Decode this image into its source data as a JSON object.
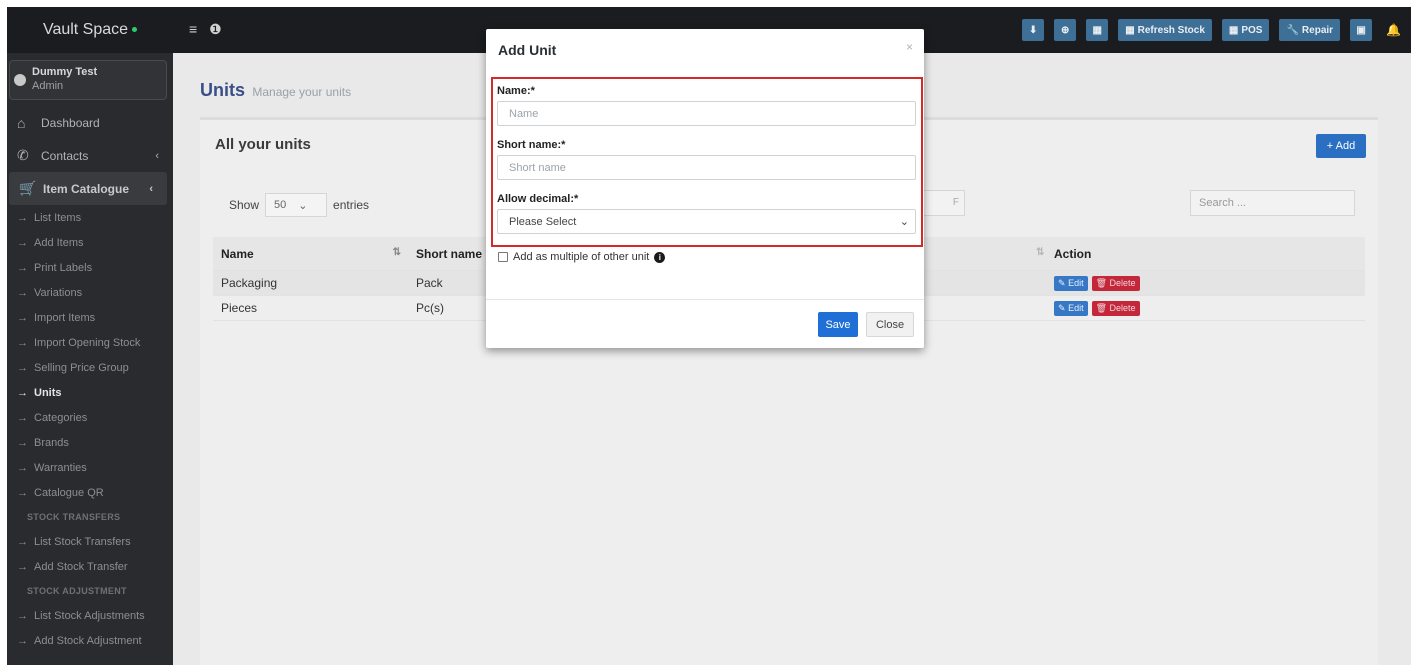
{
  "brand": "Vault Space",
  "topbar_icons": [
    "≡",
    "❶"
  ],
  "topbar_buttons": {
    "download": "⬇",
    "add": "⊕",
    "calculator": "▦",
    "refresh_stock": "Refresh Stock",
    "pos": "POS",
    "repair": "Repair",
    "cash": "▣",
    "bell": "🔔"
  },
  "user": {
    "name": "Dummy Test",
    "role": "Admin"
  },
  "sidebar": {
    "dashboard": "Dashboard",
    "contacts": "Contacts",
    "item_catalogue": "Item Catalogue",
    "catalogue_items": [
      "List Items",
      "Add Items",
      "Print Labels",
      "Variations",
      "Import Items",
      "Import Opening Stock",
      "Selling Price Group",
      "Units",
      "Categories",
      "Brands",
      "Warranties",
      "Catalogue QR"
    ],
    "stock_transfers_heading": "STOCK TRANSFERS",
    "stock_transfers_items": [
      "List Stock Transfers",
      "Add Stock Transfer"
    ],
    "stock_adjustment_heading": "STOCK ADJUSTMENT",
    "stock_adjustment_items": [
      "List Stock Adjustments",
      "Add Stock Adjustment"
    ]
  },
  "page": {
    "title": "Units",
    "subtitle": "Manage your units"
  },
  "box": {
    "title": "All your units",
    "add_label": "+ Add",
    "show_label": "Show",
    "entries_value": "50",
    "entries_label": "entries",
    "search_placeholder": "Search ..."
  },
  "table": {
    "headers": {
      "name": "Name",
      "short_name": "Short name",
      "action": "Action"
    },
    "rows": [
      {
        "name": "Packaging",
        "short_name": "Pack"
      },
      {
        "name": "Pieces",
        "short_name": "Pc(s)"
      }
    ],
    "edit_label": "Edit",
    "delete_label": "Delete"
  },
  "modal": {
    "title": "Add Unit",
    "close_x": "×",
    "name_label": "Name:*",
    "name_placeholder": "Name",
    "short_label": "Short name:*",
    "short_placeholder": "Short name",
    "decimal_label": "Allow decimal:*",
    "decimal_value": "Please Select",
    "multiple_label": "Add as multiple of other unit",
    "save": "Save",
    "close": "Close"
  },
  "colors": {
    "accent": "#2b6fc2",
    "highlight_border": "#d32a2a",
    "sidebar_bg": "#2a2b2e",
    "topbar_bg": "#1a1c1f"
  }
}
